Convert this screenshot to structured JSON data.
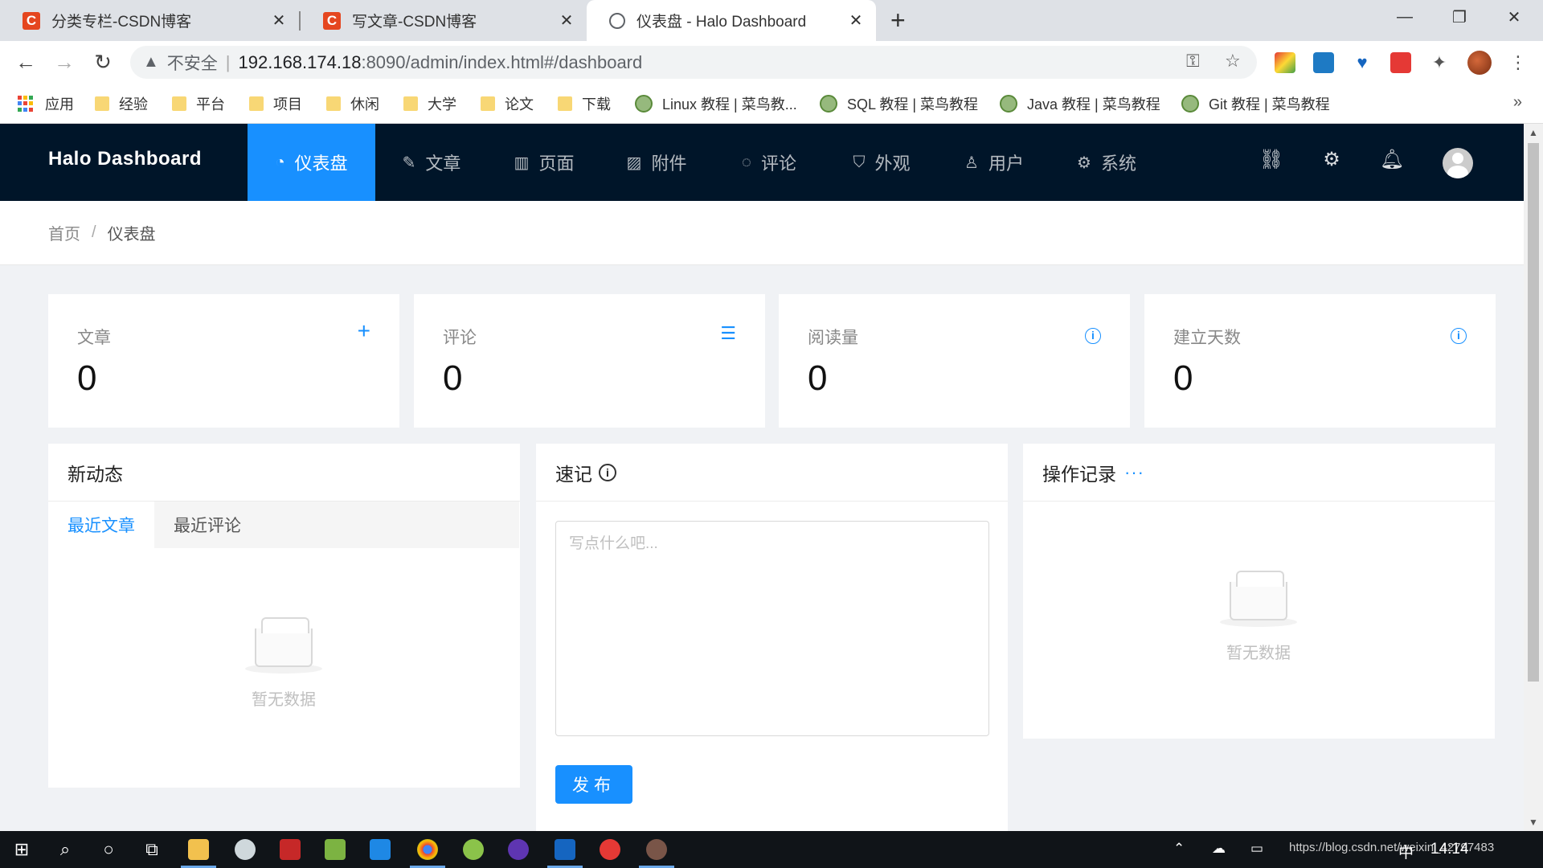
{
  "browser": {
    "tabs": [
      {
        "title": "分类专栏-CSDN博客",
        "favicon": "csdn-icon",
        "active": false
      },
      {
        "title": "写文章-CSDN博客",
        "favicon": "csdn-icon",
        "active": false
      },
      {
        "title": "仪表盘 - Halo Dashboard",
        "favicon": "globe-icon",
        "active": true
      }
    ],
    "csdn_letter": "C",
    "address": {
      "security": "不安全",
      "host": "192.168.174.18",
      "path": ":8090/admin/index.html#/dashboard"
    },
    "bookmarks": [
      {
        "label": "应用",
        "icon": "apps-icon"
      },
      {
        "label": "经验",
        "icon": "folder-icon"
      },
      {
        "label": "平台",
        "icon": "folder-icon"
      },
      {
        "label": "项目",
        "icon": "folder-icon"
      },
      {
        "label": "休闲",
        "icon": "folder-icon"
      },
      {
        "label": "大学",
        "icon": "folder-icon"
      },
      {
        "label": "论文",
        "icon": "folder-icon"
      },
      {
        "label": "下载",
        "icon": "folder-icon"
      },
      {
        "label": "Linux 教程 | 菜鸟教...",
        "icon": "runoob-icon"
      },
      {
        "label": "SQL 教程 | 菜鸟教程",
        "icon": "runoob-icon"
      },
      {
        "label": "Java 教程 | 菜鸟教程",
        "icon": "runoob-icon"
      },
      {
        "label": "Git 教程 | 菜鸟教程",
        "icon": "runoob-icon"
      }
    ]
  },
  "app": {
    "logo": "Halo  Dashboard",
    "menu": [
      {
        "label": "仪表盘",
        "icon": "dashboard-icon",
        "active": true
      },
      {
        "label": "文章",
        "icon": "edit-icon",
        "active": false
      },
      {
        "label": "页面",
        "icon": "read-icon",
        "active": false
      },
      {
        "label": "附件",
        "icon": "picture-icon",
        "active": false
      },
      {
        "label": "评论",
        "icon": "message-icon",
        "active": false
      },
      {
        "label": "外观",
        "icon": "skin-icon",
        "active": false
      },
      {
        "label": "用户",
        "icon": "user-icon",
        "active": false
      },
      {
        "label": "系统",
        "icon": "setting-icon",
        "active": false
      }
    ],
    "header_icons": [
      "link-icon",
      "setting-icon",
      "bell-icon",
      "avatar"
    ]
  },
  "breadcrumb": {
    "home": "首页",
    "separator": "/",
    "current": "仪表盘"
  },
  "stats": [
    {
      "title": "文章",
      "value": "0",
      "icon": "plus-icon"
    },
    {
      "title": "评论",
      "value": "0",
      "icon": "list-icon"
    },
    {
      "title": "阅读量",
      "value": "0",
      "icon": "info-icon"
    },
    {
      "title": "建立天数",
      "value": "0",
      "icon": "info-icon"
    }
  ],
  "activity": {
    "title": "新动态",
    "tabs": [
      "最近文章",
      "最近评论"
    ],
    "active_tab": "最近文章",
    "empty": "暂无数据"
  },
  "memo": {
    "title": "速记",
    "placeholder": "写点什么吧...",
    "value": "",
    "button": "发布"
  },
  "logs": {
    "title": "操作记录",
    "more": "···",
    "empty": "暂无数据"
  },
  "taskbar": {
    "tray_time": "14:14",
    "ime": "中",
    "watermark": "https://blog.csdn.net/weixin_42797483"
  },
  "colors": {
    "primary": "#1890ff",
    "header_bg": "#001529",
    "page_bg": "#f0f2f5"
  }
}
